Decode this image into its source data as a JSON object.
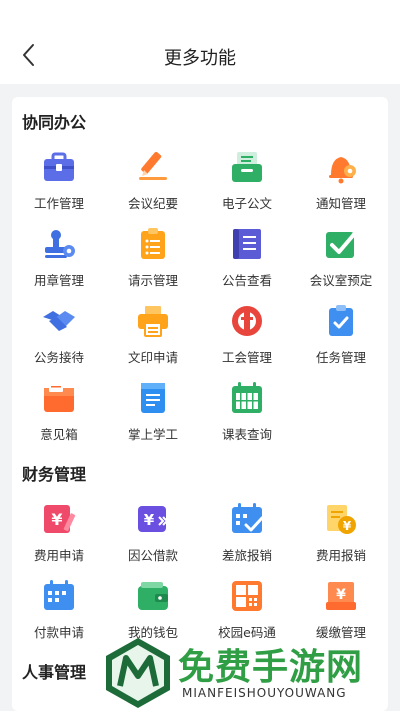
{
  "header": {
    "title": "更多功能"
  },
  "sections": [
    {
      "title": "协同办公",
      "items": [
        {
          "label": "工作管理",
          "icon": "briefcase-icon"
        },
        {
          "label": "会议纪要",
          "icon": "pencil-note-icon"
        },
        {
          "label": "电子公文",
          "icon": "document-tray-icon"
        },
        {
          "label": "通知管理",
          "icon": "bell-gear-icon"
        },
        {
          "label": "用章管理",
          "icon": "stamp-gear-icon"
        },
        {
          "label": "请示管理",
          "icon": "clipboard-list-icon"
        },
        {
          "label": "公告查看",
          "icon": "notebook-icon"
        },
        {
          "label": "会议室预定",
          "icon": "check-box-icon"
        },
        {
          "label": "公务接待",
          "icon": "handshake-icon"
        },
        {
          "label": "文印申请",
          "icon": "printer-icon"
        },
        {
          "label": "工会管理",
          "icon": "union-emblem-icon"
        },
        {
          "label": "任务管理",
          "icon": "task-clipboard-icon"
        },
        {
          "label": "意见箱",
          "icon": "mailbox-icon"
        },
        {
          "label": "掌上学工",
          "icon": "book-icon"
        },
        {
          "label": "课表查询",
          "icon": "calendar-icon"
        }
      ]
    },
    {
      "title": "财务管理",
      "items": [
        {
          "label": "费用申请",
          "icon": "yen-pen-icon"
        },
        {
          "label": "因公借款",
          "icon": "yen-card-icon"
        },
        {
          "label": "差旅报销",
          "icon": "travel-calendar-icon"
        },
        {
          "label": "费用报销",
          "icon": "yen-coins-icon"
        },
        {
          "label": "付款申请",
          "icon": "payment-calendar-icon"
        },
        {
          "label": "我的钱包",
          "icon": "wallet-icon"
        },
        {
          "label": "校园e码通",
          "icon": "qr-grid-icon"
        },
        {
          "label": "缓缴管理",
          "icon": "yen-tray-icon"
        }
      ]
    },
    {
      "title": "人事管理",
      "items": []
    }
  ],
  "watermark": {
    "title": "免费手游网",
    "subtitle": "MIANFEISHOUYOUWANG",
    "icon": "watermark-logo-icon"
  }
}
